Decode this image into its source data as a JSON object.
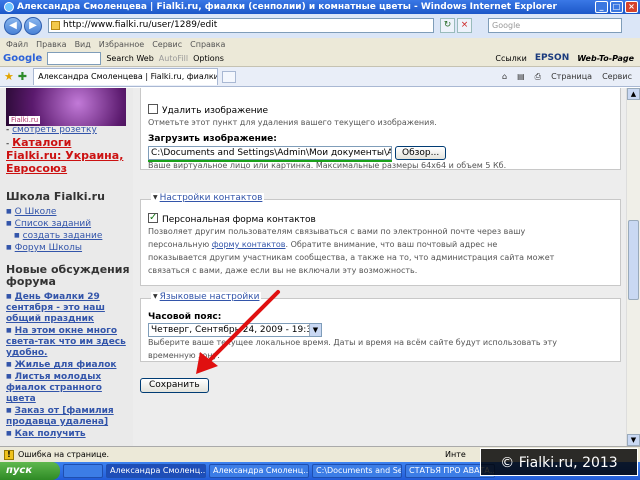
{
  "window": {
    "title": "Александра Смоленцева | Fialki.ru, фиалки (сенполии) и комнатные цветы - Windows Internet Explorer"
  },
  "address": {
    "url": "http://www.fialki.ru/user/1289/edit",
    "search_placeholder": "Google"
  },
  "menu": [
    "Файл",
    "Правка",
    "Вид",
    "Избранное",
    "Сервис",
    "Справка"
  ],
  "googlebar": {
    "logo": "Google",
    "search_web": "Search Web",
    "autofill": "AutoFill",
    "options": "Options",
    "links": "Ссылки",
    "epson": "EPSON",
    "web_to_page": "Web-To-Page"
  },
  "tabs": {
    "active": "Александра Смоленцева | Fialki.ru, фиалки (сенпол...",
    "page": "Страница",
    "service": "Сервис"
  },
  "sidebar": {
    "avatar_tag": "Fialki.ru",
    "link_rosette": "смотреть розетку",
    "catalog": "Каталоги Fialki.ru: Украина, Евросоюз",
    "school_title": "Школа Fialki.ru",
    "school_items": [
      "О Школе",
      "Список заданий",
      "создать задание",
      "Форум Школы"
    ],
    "news_title": "Новые обсуждения форума",
    "news_items": [
      "День Фиалки 29 сентября - это наш общий праздник",
      "На этом окне много света-так что им здесь удобно.",
      "Жилье для фиалок",
      "Листья молодых фиалок странного цвета",
      "Заказ от [фамилия продавца удалена]",
      "Как получить"
    ]
  },
  "form": {
    "delete_image_label": "Удалить изображение",
    "delete_image_hint": "Отметьте этот пункт для удаления вашего текущего изображения.",
    "upload_label": "Загрузить изображение:",
    "upload_path": "C:\\Documents and Settings\\Admin\\Мои документы\\АВ",
    "browse_button": "Обзор...",
    "upload_hint": "Ваше виртуальное лицо или картинка. Максимальные размеры 64x64 и объем 5 Кб.",
    "contact_legend": "Настройки контактов",
    "contact_checkbox_label": "Персональная форма контактов",
    "contact_hint_1": "Позволяет другим пользователям связываться с вами по электронной почте через вашу",
    "contact_hint_2a": "персональную ",
    "contact_hint_link": "форму контактов",
    "contact_hint_2b": ". Обратите внимание, что ваш почтовый адрес не",
    "contact_hint_3": "показывается другим участникам сообщества, а также на то, что администрация сайта может",
    "contact_hint_4": "связаться с вами, даже если вы не включали эту возможность.",
    "lang_legend": "Языковые настройки",
    "timezone_label": "Часовой пояс:",
    "timezone_value": "Четверг, Сентябрь 24, 2009 - 19:32 +0300",
    "timezone_hint_1": "Выберите ваше текущее локальное время. Даты и время на всём сайте будут использовать эту",
    "timezone_hint_2": "временную зону.",
    "save_button": "Сохранить",
    "delete_image_checked": false,
    "contact_checked": true
  },
  "status": {
    "text": "Ошибка на странице.",
    "inet": "Инте"
  },
  "taskbar": {
    "start": "пуск",
    "tasks": [
      "Александра Смоленц...",
      "Александра Смоленц...",
      "C:\\Documents and Se...",
      "СТАТЬЯ ПРО АВАТА..."
    ]
  },
  "watermark": "© Fialki.ru, 2013",
  "colors": {
    "link": "#3355aa",
    "accent_red": "#cc1111",
    "annotation_arrow": "#e01010",
    "green_underline": "#1aa11a"
  }
}
